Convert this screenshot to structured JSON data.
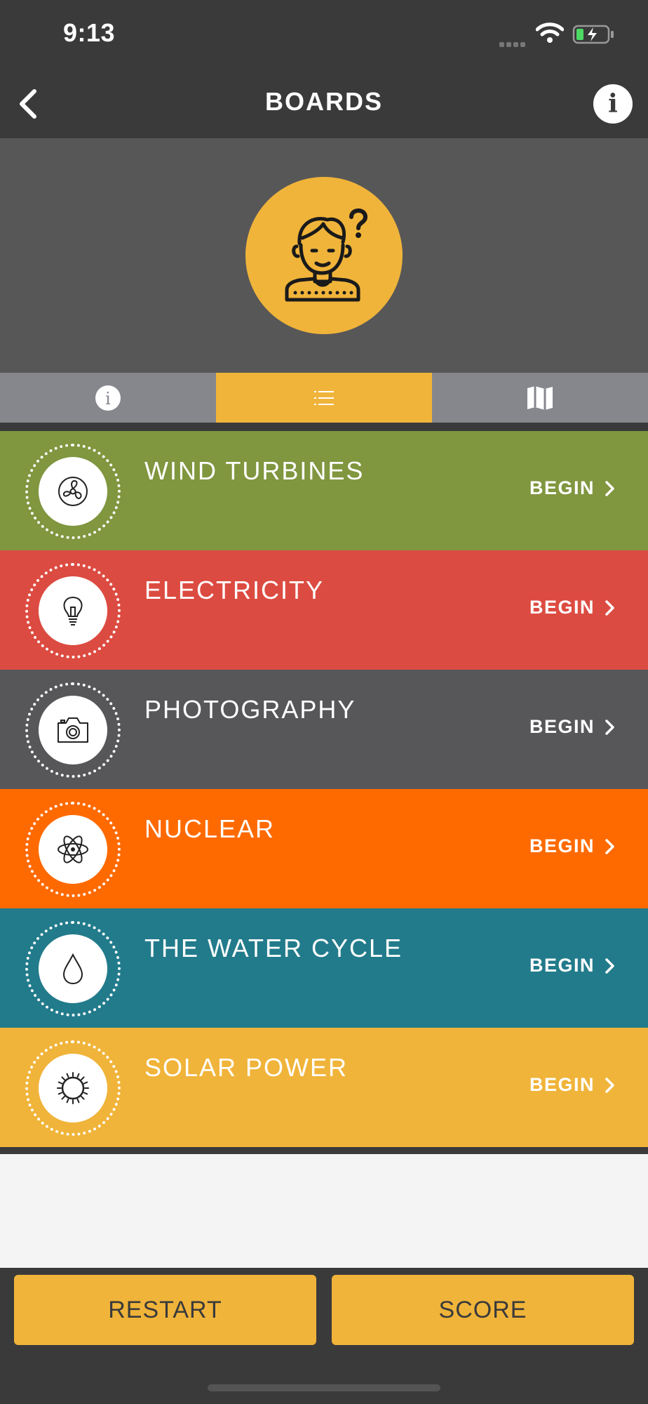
{
  "status": {
    "time": "9:13"
  },
  "nav": {
    "title": "BOARDS",
    "info_glyph": "i"
  },
  "tabs": [
    {
      "icon": "info-circle-icon",
      "active": false
    },
    {
      "icon": "list-icon",
      "active": true
    },
    {
      "icon": "map-icon",
      "active": false
    }
  ],
  "boards": [
    {
      "title": "WIND TURBINES",
      "action": "BEGIN",
      "color": "#80963f",
      "icon": "fan-icon"
    },
    {
      "title": "ELECTRICITY",
      "action": "BEGIN",
      "color": "#dc4b41",
      "icon": "lightbulb-icon"
    },
    {
      "title": "PHOTOGRAPHY",
      "action": "BEGIN",
      "color": "#57575a",
      "icon": "camera-icon"
    },
    {
      "title": "NUCLEAR",
      "action": "BEGIN",
      "color": "#fe6a00",
      "icon": "atom-icon"
    },
    {
      "title": "THE WATER CYCLE",
      "action": "BEGIN",
      "color": "#227b8b",
      "icon": "water-drop-icon"
    },
    {
      "title": "SOLAR POWER",
      "action": "BEGIN",
      "color": "#f0b43a",
      "icon": "sun-icon"
    }
  ],
  "footer": {
    "restart_label": "RESTART",
    "score_label": "SCORE"
  },
  "colors": {
    "accent": "#f0b43a",
    "bar": "#3a3a3a",
    "header": "#575757",
    "tab": "#85878d"
  }
}
